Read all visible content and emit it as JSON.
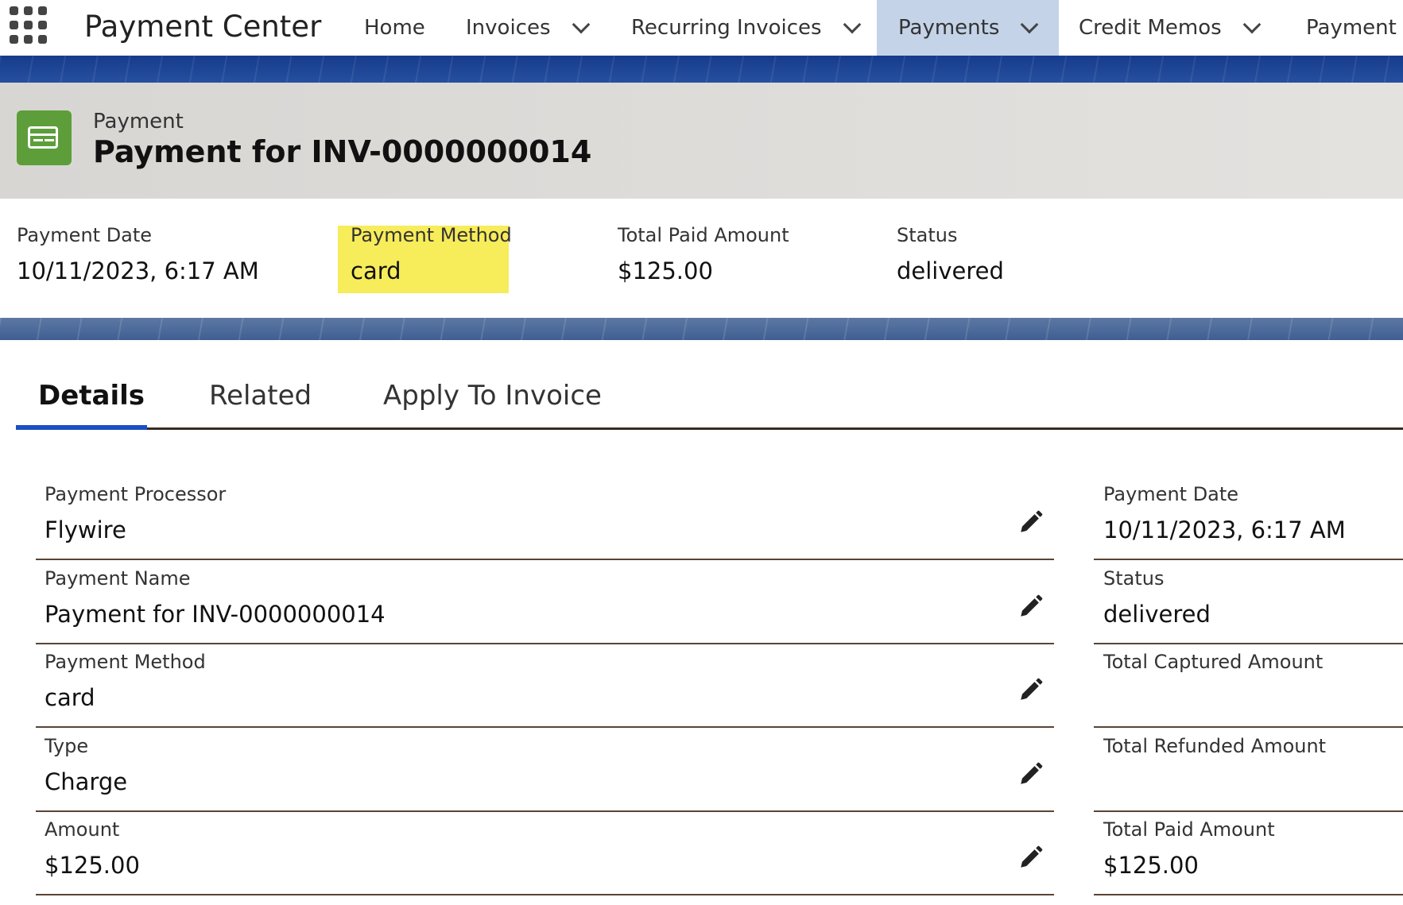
{
  "nav": {
    "app_name": "Payment Center",
    "items": [
      {
        "label": "Home",
        "has_menu": false
      },
      {
        "label": "Invoices",
        "has_menu": true
      },
      {
        "label": "Recurring Invoices",
        "has_menu": true
      },
      {
        "label": "Payments",
        "has_menu": true,
        "active": true
      },
      {
        "label": "Credit Memos",
        "has_menu": true
      },
      {
        "label": "Payment F"
      }
    ]
  },
  "record": {
    "object_type": "Payment",
    "title": "Payment for INV-0000000014",
    "icon": "credit-card-icon"
  },
  "highlights": [
    {
      "label": "Payment Date",
      "value": "10/11/2023, 6:17 AM"
    },
    {
      "label": "Payment Method",
      "value": "card"
    },
    {
      "label": "Total Paid Amount",
      "value": "$125.00"
    },
    {
      "label": "Status",
      "value": "delivered"
    }
  ],
  "tabs": [
    "Details",
    "Related",
    "Apply To Invoice"
  ],
  "details_left": [
    {
      "label": "Payment Processor",
      "value": "Flywire"
    },
    {
      "label": "Payment Name",
      "value": "Payment for INV-0000000014"
    },
    {
      "label": "Payment Method",
      "value": "card"
    },
    {
      "label": "Type",
      "value": "Charge"
    },
    {
      "label": "Amount",
      "value": "$125.00"
    }
  ],
  "details_right": [
    {
      "label": "Payment Date",
      "value": "10/11/2023, 6:17 AM"
    },
    {
      "label": "Status",
      "value": "delivered"
    },
    {
      "label": "Total Captured Amount",
      "value": ""
    },
    {
      "label": "Total Refunded Amount",
      "value": ""
    },
    {
      "label": "Total Paid Amount",
      "value": "$125.00"
    }
  ],
  "colors": {
    "accent": "#1d4fc4",
    "band": "#1b3f8f",
    "icon_green": "#5d9e3a",
    "highlight": "#f7ec5a",
    "active_nav": "#c4d3e8"
  }
}
